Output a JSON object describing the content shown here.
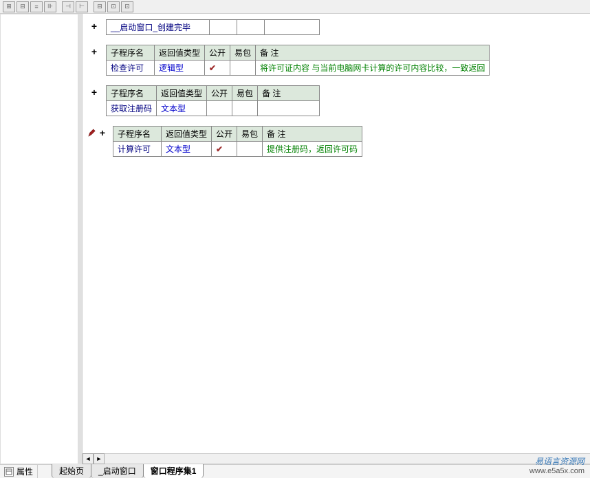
{
  "toolbar": {
    "buttons": [
      "⊞",
      "⊟",
      "⊡",
      "≡",
      "⊩",
      "⊣",
      "⊢",
      "⊟",
      "⊡",
      "⊡"
    ]
  },
  "first_row": {
    "name": "__启动窗口_创建完毕"
  },
  "tables": [
    {
      "headers": {
        "name": "子程序名",
        "type": "返回值类型",
        "public": "公开",
        "pack": "易包",
        "remark": "备  注"
      },
      "row": {
        "name": "检查许可",
        "type": "逻辑型",
        "public_check": true,
        "pack": "",
        "remark": "将许可证内容 与当前电脑网卡计算的许可内容比较，一致返回"
      }
    },
    {
      "headers": {
        "name": "子程序名",
        "type": "返回值类型",
        "public": "公开",
        "pack": "易包",
        "remark": "备  注"
      },
      "row": {
        "name": "获取注册码",
        "type": "文本型",
        "public_check": false,
        "pack": "",
        "remark": ""
      }
    },
    {
      "headers": {
        "name": "子程序名",
        "type": "返回值类型",
        "public": "公开",
        "pack": "易包",
        "remark": "备  注"
      },
      "row": {
        "name": "计算许可",
        "type": "文本型",
        "public_check": true,
        "pack": "",
        "remark": "提供注册码，返回许可码"
      },
      "editing": true
    }
  ],
  "bottom": {
    "property": "属性",
    "tabs": [
      "起始页",
      "_启动窗口",
      "窗口程序集1"
    ],
    "active_tab": 2
  },
  "watermark": {
    "line1": "易语言资源网",
    "line2": "www.e5a5x.com"
  }
}
